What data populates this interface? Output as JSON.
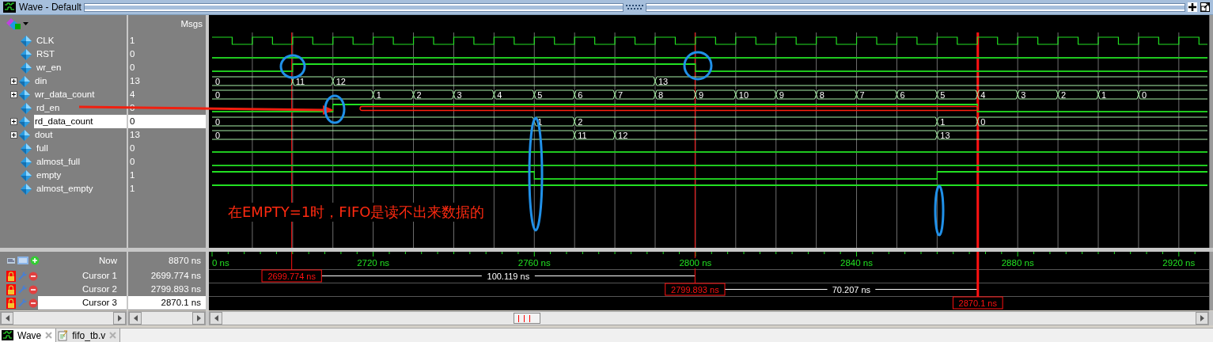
{
  "window": {
    "title": "Wave - Default"
  },
  "header": {
    "msgs_label": "Msgs"
  },
  "signals": [
    {
      "name": "CLK",
      "value": "1",
      "kind": "clock",
      "selected": false
    },
    {
      "name": "RST",
      "value": "0",
      "kind": "bit",
      "selected": false,
      "segments": [
        {
          "high": false
        }
      ]
    },
    {
      "name": "wr_en",
      "value": "0",
      "kind": "bit",
      "selected": false,
      "segments": [
        {
          "high": false
        },
        {
          "high": true
        },
        {
          "high": false
        }
      ]
    },
    {
      "name": "din",
      "value": "13",
      "kind": "bus",
      "expanded": false,
      "selected": false,
      "segments": [
        {
          "v": "0"
        },
        {
          "v": "11"
        },
        {
          "v": "12"
        },
        {
          "v": "13"
        }
      ]
    },
    {
      "name": "wr_data_count",
      "value": "4",
      "kind": "bus",
      "expanded": false,
      "selected": false,
      "segments": [
        {
          "v": "0"
        },
        {
          "v": "1"
        },
        {
          "v": "2"
        },
        {
          "v": "3"
        },
        {
          "v": "4"
        },
        {
          "v": "5"
        },
        {
          "v": "6"
        },
        {
          "v": "7"
        },
        {
          "v": "8"
        },
        {
          "v": "9"
        },
        {
          "v": "10"
        },
        {
          "v": "9"
        },
        {
          "v": "8"
        },
        {
          "v": "7"
        },
        {
          "v": "6"
        },
        {
          "v": "5"
        },
        {
          "v": "4"
        },
        {
          "v": "3"
        },
        {
          "v": "2"
        },
        {
          "v": "1"
        },
        {
          "v": "0"
        }
      ]
    },
    {
      "name": "rd_en",
      "value": "0",
      "kind": "bit",
      "selected": false,
      "segments": [
        {
          "high": false
        },
        {
          "high": true
        },
        {
          "high": false
        }
      ]
    },
    {
      "name": "rd_data_count",
      "value": "0",
      "kind": "bus",
      "expanded": false,
      "selected": true,
      "segments": [
        {
          "v": "0"
        },
        {
          "v": "1"
        },
        {
          "v": "2"
        },
        {
          "v": "1"
        },
        {
          "v": "0"
        }
      ]
    },
    {
      "name": "dout",
      "value": "13",
      "kind": "bus",
      "expanded": false,
      "selected": false,
      "segments": [
        {
          "v": "0"
        },
        {
          "v": "11"
        },
        {
          "v": "12"
        },
        {
          "v": "13"
        }
      ]
    },
    {
      "name": "full",
      "value": "0",
      "kind": "bit",
      "selected": false,
      "segments": [
        {
          "high": false
        }
      ]
    },
    {
      "name": "almost_full",
      "value": "0",
      "kind": "bit",
      "selected": false,
      "segments": [
        {
          "high": false
        }
      ]
    },
    {
      "name": "empty",
      "value": "1",
      "kind": "bit",
      "selected": false,
      "segments": [
        {
          "high": true
        },
        {
          "high": false
        },
        {
          "high": true
        }
      ]
    },
    {
      "name": "almost_empty",
      "value": "1",
      "kind": "bit",
      "selected": false,
      "segments": [
        {
          "high": true
        }
      ]
    }
  ],
  "annotation": {
    "note": "在EMPTY=1时，FIFO是读不出来数据的"
  },
  "axis": {
    "labels": [
      "0 ns",
      "2720 ns",
      "2760 ns",
      "2800 ns",
      "2840 ns",
      "2880 ns",
      "2920 ns"
    ]
  },
  "now": {
    "label": "Now",
    "value": "8870 ns"
  },
  "cursors": [
    {
      "name": "Cursor 1",
      "value": "2699.774 ns",
      "marker": "2699.774 ns",
      "delta": "100.119 ns",
      "locked": true,
      "selected": false
    },
    {
      "name": "Cursor 2",
      "value": "2799.893 ns",
      "marker": "2799.893 ns",
      "delta": "70.207 ns",
      "locked": true,
      "selected": false
    },
    {
      "name": "Cursor 3",
      "value": "2870.1 ns",
      "marker": "2870.1 ns",
      "locked": true,
      "selected": true
    }
  ],
  "tabs": [
    {
      "label": "Wave",
      "selected": true,
      "kind": "wave"
    },
    {
      "label": "fifo_tb.v",
      "selected": false,
      "kind": "file"
    }
  ]
}
